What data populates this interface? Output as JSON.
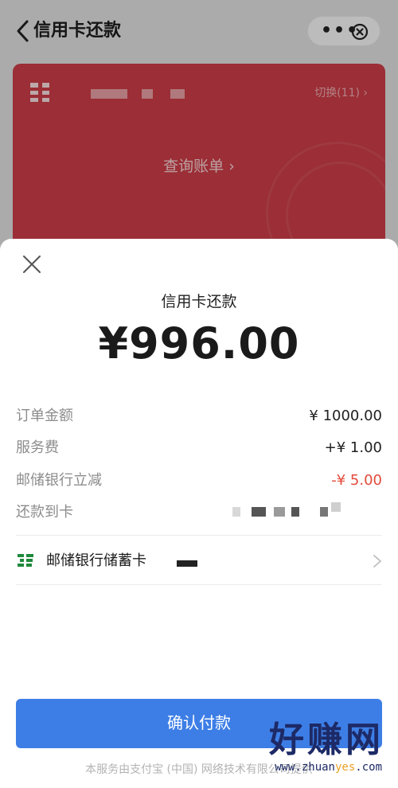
{
  "header": {
    "title": "信用卡还款",
    "more_label": "•••"
  },
  "card": {
    "switch_label": "切换(11) ›",
    "query_label": "查询账单 ›"
  },
  "sheet": {
    "title": "信用卡还款",
    "amount": "¥996.00",
    "rows": [
      {
        "label": "订单金额",
        "value": "¥ 1000.00",
        "tone": "normal"
      },
      {
        "label": "服务费",
        "value": "+¥ 1.00",
        "tone": "normal"
      },
      {
        "label": "邮储银行立减",
        "value": "-¥ 5.00",
        "tone": "discount"
      },
      {
        "label": "还款到卡",
        "value": ""
      }
    ],
    "payment_method": {
      "label": "邮储银行储蓄卡"
    },
    "confirm_label": "确认付款",
    "footer_note": "本服务由支付宝 (中国) 网络技术有限公司提供"
  },
  "watermark": {
    "text": "好赚网",
    "url_prefix": "www.zhuan",
    "url_highlight": "yes",
    "url_suffix": ".com"
  },
  "colors": {
    "accent": "#3d7ee6",
    "discount": "#e34a3a",
    "card": "#c73b46",
    "bank_green": "#1f8a3c"
  }
}
